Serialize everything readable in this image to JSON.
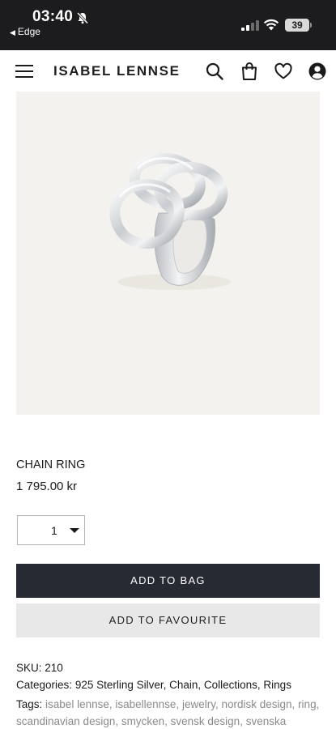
{
  "status_bar": {
    "time": "03:40",
    "back_app": "Edge",
    "battery": "39"
  },
  "header": {
    "brand": "ISABEL LENNSE"
  },
  "product": {
    "image_alt": "Chain ring",
    "name": "CHAIN RING",
    "price": "1 795.00 kr",
    "quantity": "1",
    "add_to_bag": "ADD TO BAG",
    "add_to_favourite": "ADD TO FAVOURITE"
  },
  "meta": {
    "sku_label": "SKU:",
    "sku_value": "210",
    "categories_label": "Categories:",
    "categories": "925 Sterling Silver, Chain, Collections, Rings",
    "tags_label": "Tags:",
    "tags": [
      "isabel lennse",
      "isabellennse",
      "jewelry",
      "nordisk design",
      "ring",
      "scandinavian design",
      "smycken",
      "svensk design",
      "svenska"
    ]
  },
  "icons": {
    "menu": "hamburger-icon",
    "search": "search-icon",
    "bag": "shopping-bag-icon",
    "favourite": "heart-icon",
    "account": "user-circle-icon",
    "mute": "bell-slash-icon",
    "signal": "cellular-signal-icon",
    "wifi": "wifi-icon"
  }
}
